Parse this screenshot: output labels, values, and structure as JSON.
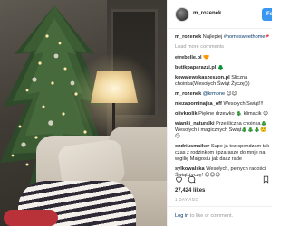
{
  "post": {
    "username": "m_rozenek",
    "follow_label": "Follow",
    "caption_user": "m_rozenek",
    "caption_text": "Najlepiej ",
    "caption_hashtag": "#homesweethome",
    "load_more": "Load more comments",
    "comments": [
      {
        "user": "etrebelle.pl",
        "text": "🧡"
      },
      {
        "user": "butikpaparazzi.pl",
        "text": "🌲"
      },
      {
        "user": "kowalewskaszeszon.pl",
        "text": "Śliczna choinka(Wesołych Świąt Życzę)))"
      },
      {
        "user": "m_rozenek",
        "mention": "@krmone",
        "text": "😊😊"
      },
      {
        "user": "niezapominajka_off",
        "text": "Wesołych Świąt!!!"
      },
      {
        "user": "olivkrolik",
        "text": "Piękne drzewko 🎄 klimacik 😊"
      },
      {
        "user": "wianki_naturalki",
        "text": "Prześliczna choinka🎄 Wesołych i magicznych Świąt🎄🎄🎄☺️😊"
      },
      {
        "user": "endriusmaiker",
        "text": "Supe ja tez spendzam tak czas z rodzinkom i pzarasze do mnje na wigilię Małgosiu jak dasz rade"
      },
      {
        "user": "sylkowalska",
        "text": "Wesołych, pełnych radości Świąt życzę! 😊😊😊"
      }
    ],
    "likes": "27,424 likes",
    "date": "1 DAY AGO",
    "login_prefix": "Log in",
    "login_suffix": " to like or comment."
  },
  "colors": {
    "accent": "#3897f0",
    "link": "#003569",
    "muted": "#999999",
    "heart": "#ed4956"
  },
  "icons": [
    "heart-icon",
    "comment-icon",
    "bookmark-icon",
    "avatar"
  ]
}
